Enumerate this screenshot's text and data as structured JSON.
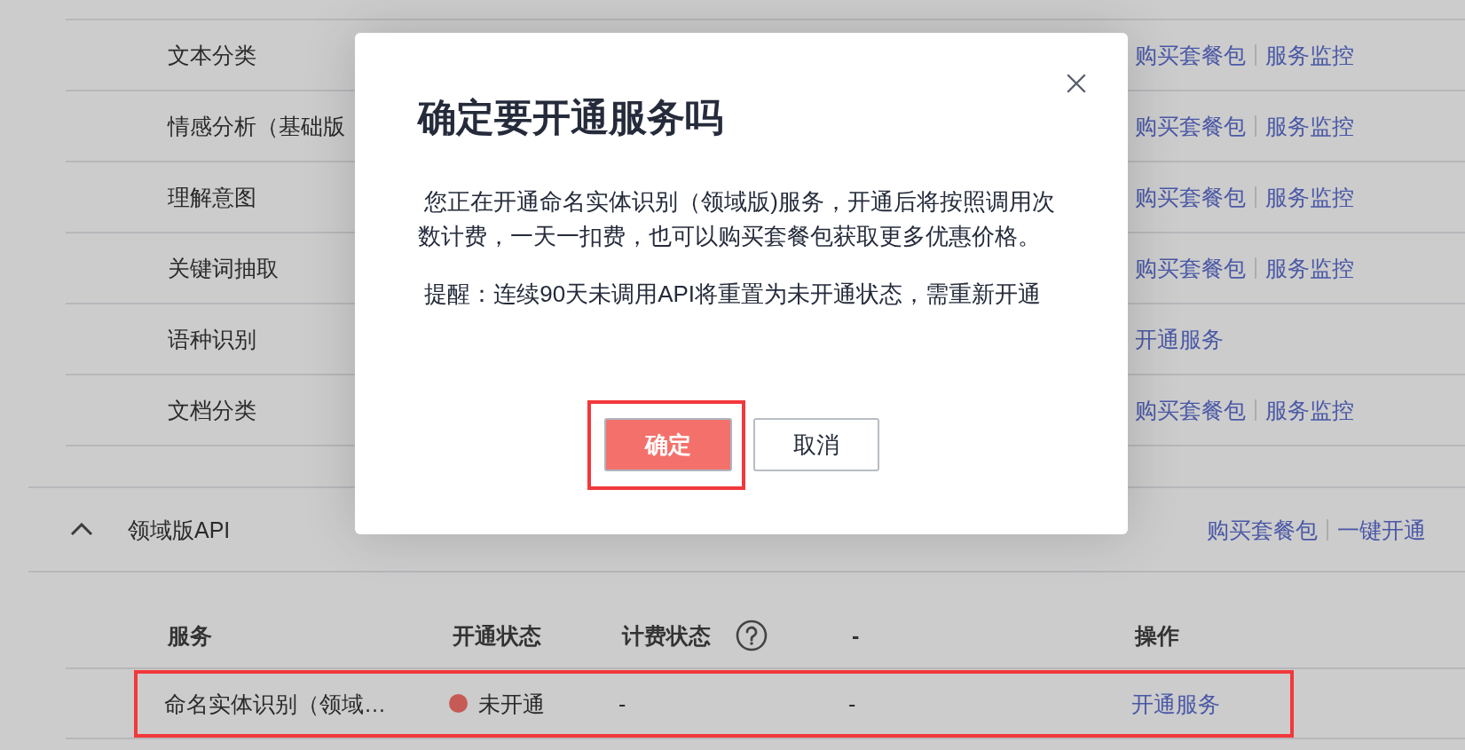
{
  "services": [
    {
      "name": "文本分类",
      "actions": [
        "购买套餐包",
        "服务监控"
      ]
    },
    {
      "name": "情感分析（基础版",
      "actions": [
        "购买套餐包",
        "服务监控"
      ]
    },
    {
      "name": "理解意图",
      "actions": [
        "购买套餐包",
        "服务监控"
      ]
    },
    {
      "name": "关键词抽取",
      "actions": [
        "购买套餐包",
        "服务监控"
      ]
    },
    {
      "name": "语种识别",
      "actions": [
        "开通服务"
      ]
    },
    {
      "name": "文档分类",
      "actions": [
        "购买套餐包",
        "服务监控"
      ]
    }
  ],
  "domain_section": {
    "title": "领域版API",
    "expanded": true,
    "actions": [
      "购买套餐包",
      "一键开通"
    ],
    "columns": [
      {
        "label": "服务",
        "help": false
      },
      {
        "label": "开通状态",
        "help": false
      },
      {
        "label": "计费状态",
        "help": true
      },
      {
        "label": "-",
        "help": false
      },
      {
        "label": "操作",
        "help": false
      }
    ],
    "rows": [
      {
        "service": "命名实体识别（领域…",
        "status": {
          "label": "未开通",
          "color": "#c65b56"
        },
        "billing": "-",
        "column_4": "-",
        "actions": [
          "开通服务"
        ],
        "highlighted": true
      }
    ]
  },
  "dialog": {
    "title": "确定要开通服务吗",
    "messages": [
      " 您正在开通命名实体识别（领域版)服务，开通后将按照调用次数计费，一天一扣费，也可以购买套餐包获取更多优惠价格。",
      " 提醒：连续90天未调用API将重置为未开通状态，需重新开通"
    ],
    "buttons": [
      {
        "label": "确定",
        "kind": "primary",
        "highlighted": true
      },
      {
        "label": "取消",
        "kind": "secondary",
        "highlighted": false
      }
    ]
  }
}
